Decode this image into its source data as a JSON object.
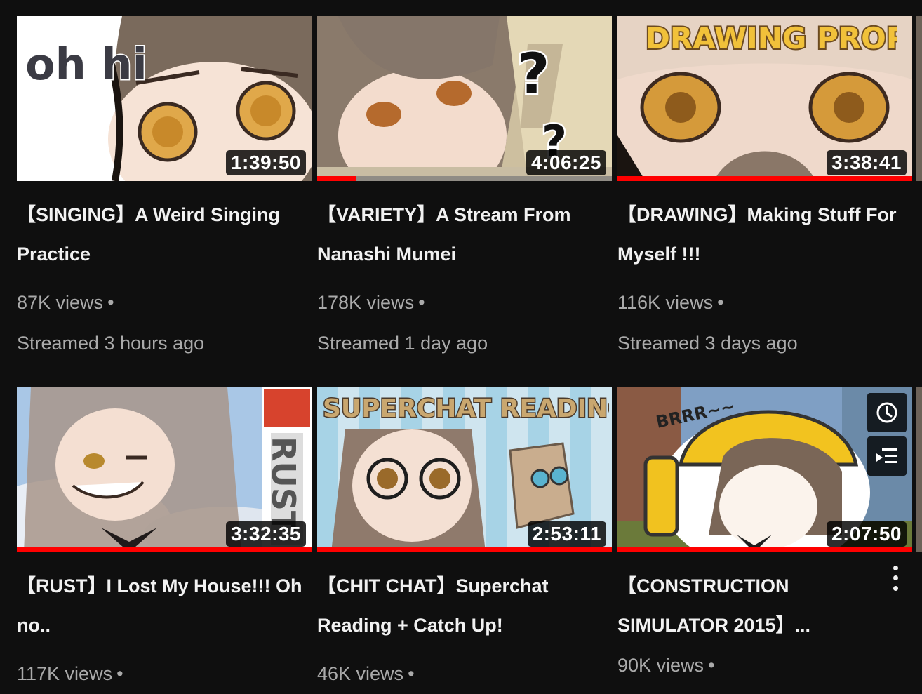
{
  "videos": [
    {
      "title": "【SINGING】A Weird Singing Practice",
      "duration": "1:39:50",
      "views": "87K views",
      "age": "Streamed 3 hours ago",
      "progress": 0,
      "thumb_text": "oh hi"
    },
    {
      "title": "【VARIETY】A Stream From Nanashi Mumei",
      "duration": "4:06:25",
      "views": "178K views",
      "age": "Streamed 1 day ago",
      "progress": 0.13,
      "thumb_text": "?"
    },
    {
      "title": "【DRAWING】Making Stuff For Myself !!!",
      "duration": "3:38:41",
      "views": "116K views",
      "age": "Streamed 3 days ago",
      "progress": 1,
      "thumb_text": "DRAWING PROPS"
    },
    {
      "title": "【RUST】I Lost My House!!! Oh no..",
      "duration": "3:32:35",
      "views": "117K views",
      "age": "",
      "progress": 1,
      "thumb_text": "RUST"
    },
    {
      "title": "【CHIT CHAT】Superchat Reading + Catch Up!",
      "duration": "2:53:11",
      "views": "46K views",
      "age": "",
      "progress": 1,
      "thumb_text": "SUPERCHAT READING"
    },
    {
      "title": "【CONSTRUCTION SIMULATOR 2015】...",
      "duration": "2:07:50",
      "views": "90K views",
      "age": "",
      "progress": 1,
      "thumb_text": "BRRR~~"
    }
  ],
  "icons": {
    "watch_later": "clock-icon",
    "add_to_queue": "queue-icon",
    "more_actions": "more-vert-icon"
  },
  "colors": {
    "background": "#0f0f0f",
    "progress": "#ff0000",
    "meta_text": "#aaaaaa",
    "title_text": "#f1f1f1"
  }
}
